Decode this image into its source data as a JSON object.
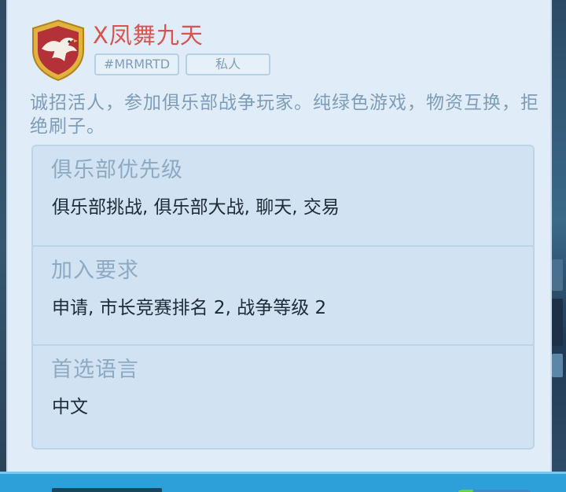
{
  "club": {
    "name": "X凤舞九天",
    "tag": "#MRMRTD",
    "type": "私人",
    "description": "诚招活人，参加俱乐部战争玩家。纯绿色游戏，物资互换，拒绝刷子。",
    "badge_icon": "eagle-shield-icon"
  },
  "sections": [
    {
      "title": "俱乐部优先级",
      "value": "俱乐部挑战, 俱乐部大战, 聊天, 交易"
    },
    {
      "title": "加入要求",
      "value": "申请, 市长竞赛排名 2, 战争等级 2"
    },
    {
      "title": "首选语言",
      "value": "中文"
    }
  ],
  "colors": {
    "name": "#d9534f",
    "panel": "#e0edf8",
    "info_box": "#d1e3f2",
    "section_title": "#8eaac2",
    "bottom_bar": "#2d9fd9"
  }
}
